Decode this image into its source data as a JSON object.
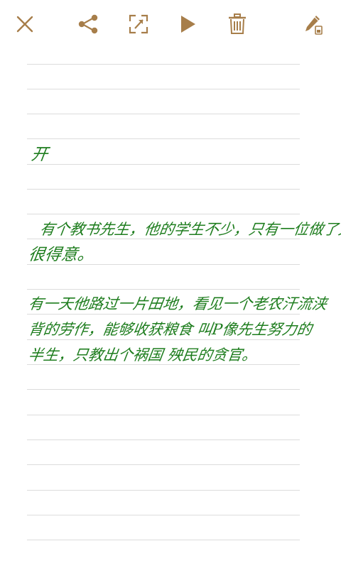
{
  "toolbar": {
    "icons": [
      "close-icon",
      "share-icon",
      "crop-icon",
      "play-icon",
      "trash-icon",
      "pen-icon"
    ],
    "icon_color": "#a77e4a"
  },
  "note": {
    "ink_color": "#1e7d1e",
    "rule_color": "#dcdcdc",
    "rule_count": 20,
    "lines": [
      "开",
      "有个教书先生，他的学生不少，只有一位做了大官",
      "很得意。",
      "有一天他路过一片田地，看见一个老农汗流浃",
      "背的劳作，能够收获粮食 叫P像先生努力的",
      "半生，只教出个祸国 殃民的贪官。"
    ]
  }
}
